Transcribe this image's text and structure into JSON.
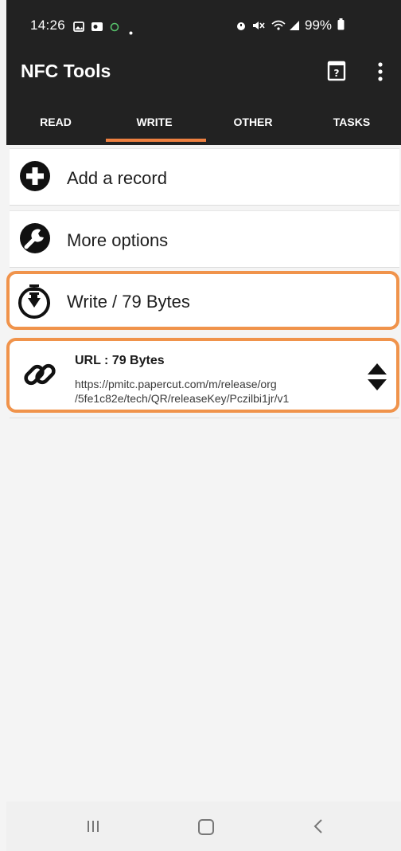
{
  "status_bar": {
    "time": "14:26",
    "battery": "99%"
  },
  "app_bar": {
    "title": "NFC Tools"
  },
  "tabs": [
    {
      "label": "READ"
    },
    {
      "label": "WRITE"
    },
    {
      "label": "OTHER"
    },
    {
      "label": "TASKS"
    }
  ],
  "active_tab": "WRITE",
  "actions": {
    "add_record": "Add a record",
    "more_options": "More options",
    "write": "Write / 79 Bytes"
  },
  "record": {
    "title": "URL : 79 Bytes",
    "url_line_1": "https://pmitc.papercut.com/m/release/org",
    "url_line_2": "/5fe1c82e/tech/QR/releaseKey/Pczilbi1jr/v1"
  },
  "colors": {
    "toolbar_bg": "#222222",
    "accent": "#ee8040",
    "highlight_border": "#f0934b"
  },
  "icons": {
    "add_record": "plus-circle-icon",
    "more_options": "wrench-icon",
    "write": "download-write-icon",
    "record": "link-icon",
    "reorder": "sort-arrows-icon",
    "help": "help-book-icon",
    "overflow": "more-vert-icon"
  }
}
